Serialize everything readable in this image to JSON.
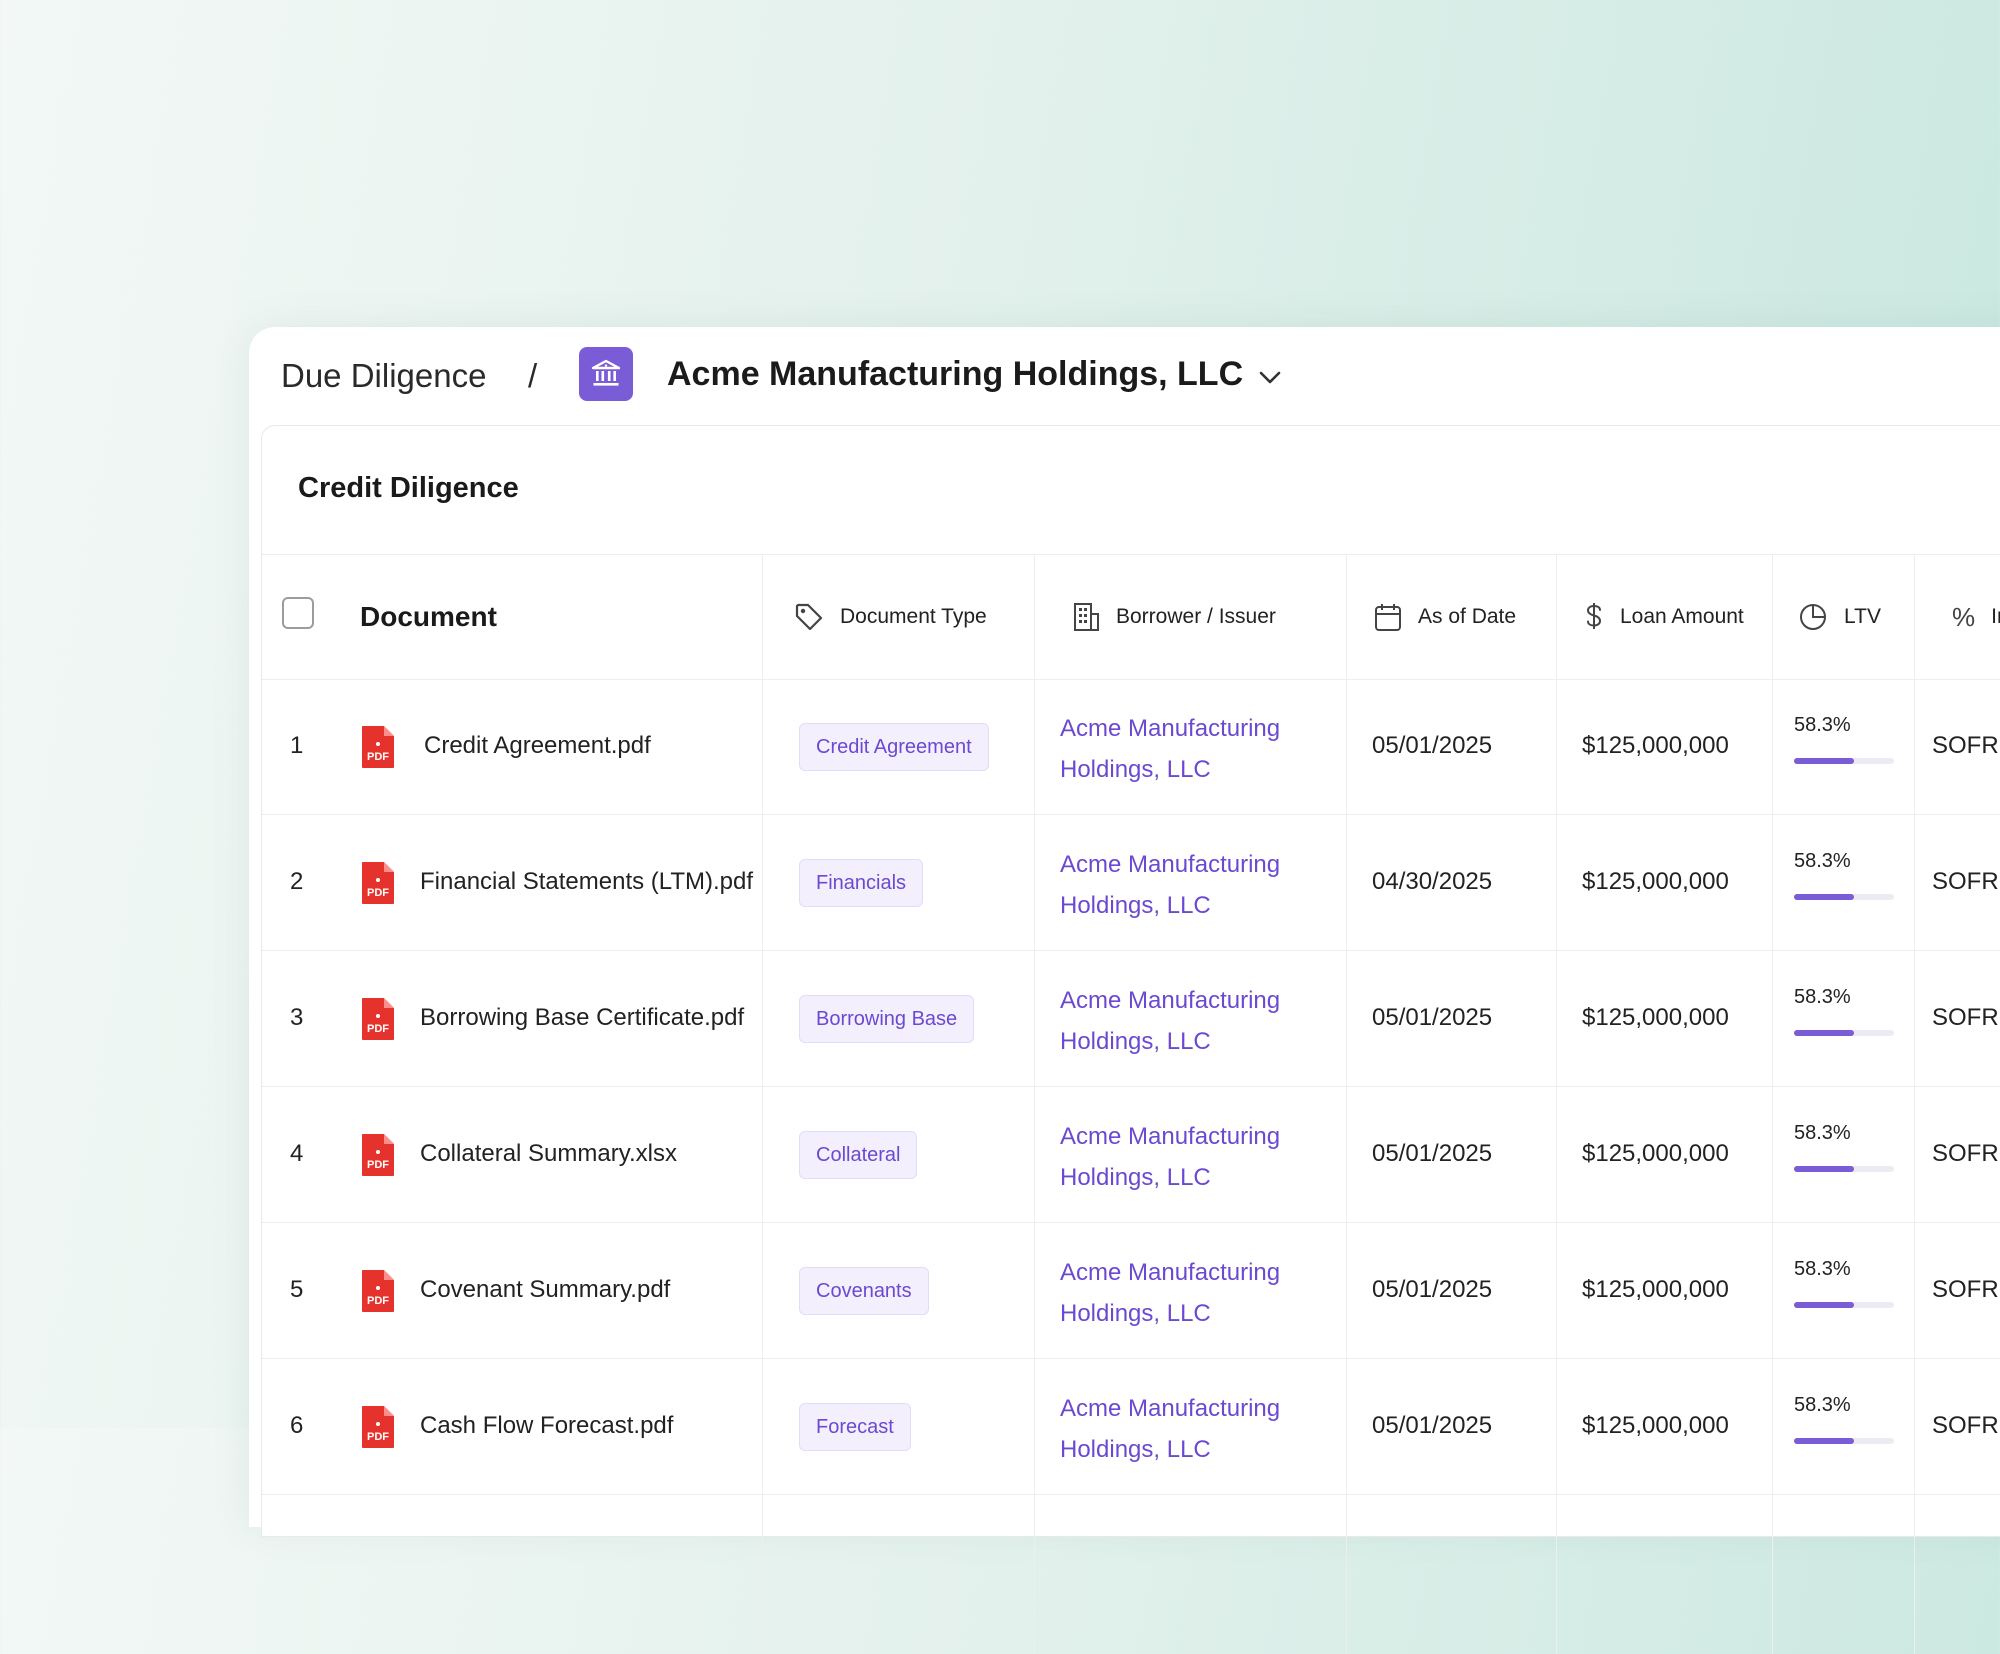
{
  "breadcrumb": {
    "root": "Due Diligence",
    "separator": "/",
    "current": "Acme Manufacturing Holdings, LLC"
  },
  "card": {
    "title": "Credit Diligence"
  },
  "table": {
    "headers": {
      "document": "Document",
      "document_type": "Document Type",
      "borrower": "Borrower / Issuer",
      "as_of_date": "As of Date",
      "loan_amount": "Loan Amount",
      "ltv": "LTV",
      "rate_icon": "%",
      "rate": "In"
    },
    "rows": [
      {
        "num": "1",
        "file": "Credit Agreement.pdf",
        "type": "Credit Agreement",
        "borrower_line1": "Acme Manufacturing",
        "borrower_line2": "Holdings, LLC",
        "date": "05/01/2025",
        "amount": "$125,000,000",
        "ltv": "58.3%",
        "ltv_fraction": 0.6,
        "rate": "SOFR +"
      },
      {
        "num": "2",
        "file": "Financial Statements (LTM).pdf",
        "type": "Financials",
        "borrower_line1": "Acme Manufacturing",
        "borrower_line2": "Holdings, LLC",
        "date": "04/30/2025",
        "amount": "$125,000,000",
        "ltv": "58.3%",
        "ltv_fraction": 0.6,
        "rate": "SOFR +"
      },
      {
        "num": "3",
        "file": "Borrowing Base Certificate.pdf",
        "type": "Borrowing Base",
        "borrower_line1": "Acme Manufacturing",
        "borrower_line2": "Holdings, LLC",
        "date": "05/01/2025",
        "amount": "$125,000,000",
        "ltv": "58.3%",
        "ltv_fraction": 0.6,
        "rate": "SOFR +"
      },
      {
        "num": "4",
        "file": "Collateral Summary.xlsx",
        "type": "Collateral",
        "borrower_line1": "Acme Manufacturing",
        "borrower_line2": "Holdings, LLC",
        "date": "05/01/2025",
        "amount": "$125,000,000",
        "ltv": "58.3%",
        "ltv_fraction": 0.6,
        "rate": "SOFR +"
      },
      {
        "num": "5",
        "file": "Covenant Summary.pdf",
        "type": "Covenants",
        "borrower_line1": "Acme Manufacturing",
        "borrower_line2": "Holdings, LLC",
        "date": "05/01/2025",
        "amount": "$125,000,000",
        "ltv": "58.3%",
        "ltv_fraction": 0.6,
        "rate": "SOFR +"
      },
      {
        "num": "6",
        "file": "Cash Flow Forecast.pdf",
        "type": "Forecast",
        "borrower_line1": "Acme Manufacturing",
        "borrower_line2": "Holdings, LLC",
        "date": "05/01/2025",
        "amount": "$125,000,000",
        "ltv": "58.3%",
        "ltv_fraction": 0.6,
        "rate": "SOFR +"
      }
    ]
  },
  "icons": {
    "bank": "bank-icon",
    "tag": "tag-icon",
    "building": "building-icon",
    "calendar": "calendar-icon",
    "dollar": "dollar-icon",
    "pie": "pie-chart-icon",
    "file": "pdf-file-icon"
  },
  "colors": {
    "accent": "#7a5cd6",
    "link": "#6b49d1",
    "pdf_red": "#e5322d"
  }
}
